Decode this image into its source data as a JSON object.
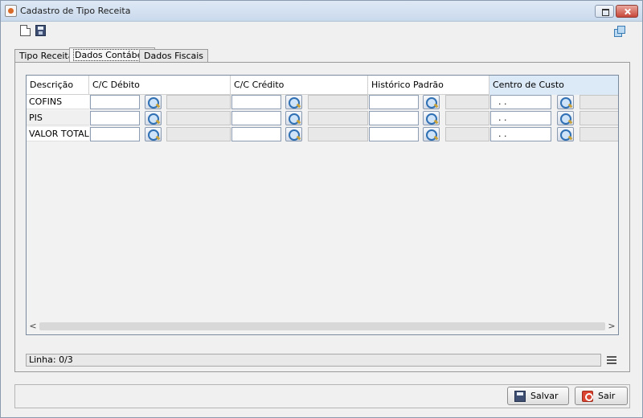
{
  "window": {
    "title": "Cadastro de Tipo Receita"
  },
  "tabs": [
    {
      "label": "Tipo Receita"
    },
    {
      "label": "Dados Contábeis"
    },
    {
      "label": "Dados Fiscais"
    }
  ],
  "grid": {
    "columns": [
      {
        "label": "Descrição"
      },
      {
        "label": "C/C Débito"
      },
      {
        "label": "C/C Crédito"
      },
      {
        "label": "Histórico Padrão"
      },
      {
        "label": "Centro de Custo"
      }
    ],
    "rows": [
      {
        "label": "COFINS",
        "cc_debito": "",
        "cc_credito": "",
        "historico": "",
        "centro_custo": ". ."
      },
      {
        "label": "PIS",
        "cc_debito": "",
        "cc_credito": "",
        "historico": "",
        "centro_custo": ". ."
      },
      {
        "label": "VALOR TOTAL",
        "cc_debito": "",
        "cc_credito": "",
        "historico": "",
        "centro_custo": ". ."
      }
    ],
    "scroll": {
      "left_arrow": "<",
      "right_arrow": ">"
    }
  },
  "status": {
    "line": "Linha: 0/3"
  },
  "actions": {
    "save_label": "Salvar",
    "exit_label": "Sair"
  },
  "icons": {
    "new": "new-document-icon",
    "save": "save-icon",
    "windows": "cascade-windows-icon",
    "lookup": "lookup-search-icon",
    "menu": "menu-icon",
    "exit": "exit-icon"
  },
  "colors": {
    "highlight_column": "#dce9f7",
    "close_button": "#c8473a"
  }
}
